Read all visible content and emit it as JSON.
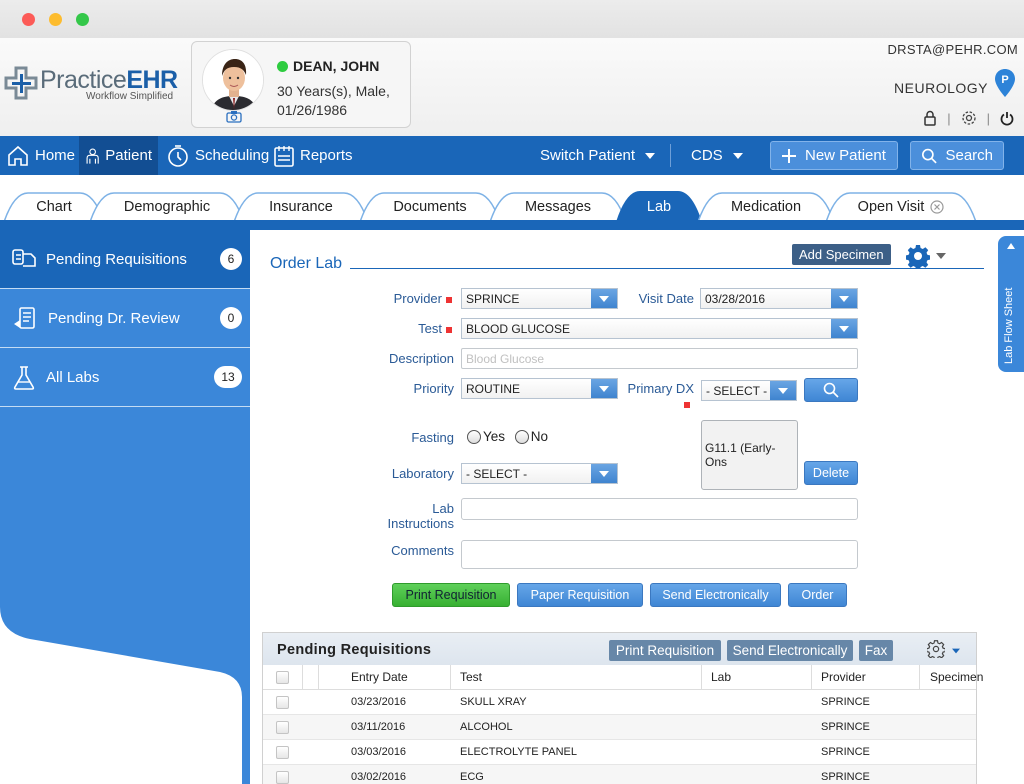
{
  "app": {
    "logo_main": "Practice",
    "logo_accent": "EHR",
    "tagline": "Workflow Simplified"
  },
  "patient": {
    "name": "DEAN, JOHN",
    "line1": "30 Years(s), Male,",
    "line2": "01/26/1986",
    "status_color": "#2ecc40"
  },
  "user": {
    "email": "DRSTA@PEHR.COM",
    "department": "NEUROLOGY"
  },
  "nav": {
    "items": [
      {
        "label": "Home",
        "icon": "home-icon"
      },
      {
        "label": "Patient",
        "icon": "person-icon"
      },
      {
        "label": "Scheduling",
        "icon": "clock-icon"
      },
      {
        "label": "Reports",
        "icon": "calendar-icon"
      }
    ],
    "switch_patient": "Switch Patient",
    "cds": "CDS",
    "new_patient": "New Patient",
    "search": "Search"
  },
  "tabs": [
    "Chart",
    "Demographic",
    "Insurance",
    "Documents",
    "Messages",
    "Lab",
    "Medication",
    "Open Visit"
  ],
  "sidebar": {
    "items": [
      {
        "label": "Pending Requisitions",
        "count": "6"
      },
      {
        "label": "Pending Dr. Review",
        "count": "0"
      },
      {
        "label": "All Labs",
        "count": "13"
      }
    ]
  },
  "flow_sheet": "Lab Flow Sheet",
  "order": {
    "title": "Order Lab",
    "add_specimen": "Add Specimen",
    "provider_label": "Provider",
    "provider_value": "SPRINCE",
    "visit_date_label": "Visit Date",
    "visit_date_value": "03/28/2016",
    "test_label": "Test",
    "test_value": "BLOOD GLUCOSE",
    "description_label": "Description",
    "description_placeholder": "Blood Glucose",
    "priority_label": "Priority",
    "priority_value": "ROUTINE",
    "primary_dx_label": "Primary DX",
    "primary_dx_value": "- SELECT -",
    "dx_selected": "G11.1 (Early-Ons",
    "delete": "Delete",
    "fasting_label": "Fasting",
    "fasting_yes": "Yes",
    "fasting_no": "No",
    "laboratory_label": "Laboratory",
    "laboratory_value": "- SELECT -",
    "lab_instructions_label_1": "Lab",
    "lab_instructions_label_2": "Instructions",
    "comments_label": "Comments",
    "buttons": {
      "print": "Print Requisition",
      "paper": "Paper Requisition",
      "send": "Send Electronically",
      "order": "Order"
    }
  },
  "pending": {
    "title": "Pending Requisitions",
    "buttons": {
      "print": "Print Requisition",
      "send": "Send Electronically",
      "fax": "Fax"
    },
    "columns": [
      "Entry Date",
      "Test",
      "Lab",
      "Provider",
      "Specimen"
    ],
    "rows": [
      {
        "date": "03/23/2016",
        "test": "SKULL XRAY",
        "lab": "",
        "provider": "SPRINCE"
      },
      {
        "date": "03/11/2016",
        "test": "ALCOHOL",
        "lab": "",
        "provider": "SPRINCE"
      },
      {
        "date": "03/03/2016",
        "test": "ELECTROLYTE PANEL",
        "lab": "",
        "provider": "SPRINCE"
      },
      {
        "date": "03/02/2016",
        "test": "ECG",
        "lab": "",
        "provider": "SPRINCE"
      }
    ]
  },
  "colors": {
    "nav_blue": "#1a66b8",
    "sidebar_blue": "#3b87d9",
    "title_blue": "#1a66b8",
    "green": "#37b032"
  }
}
